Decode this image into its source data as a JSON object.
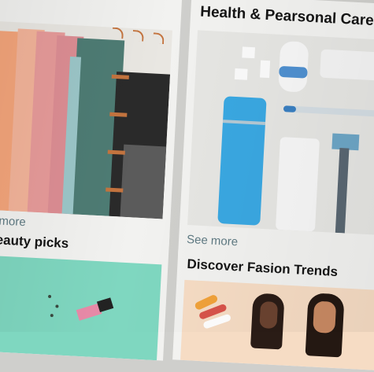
{
  "cards": {
    "home": {
      "see_more": "e more"
    },
    "health": {
      "title": "Health & Pearsonal Care",
      "see_more": "See more"
    },
    "beauty": {
      "title": "eauty picks"
    },
    "fashion": {
      "title": "Discover Fasion Trends"
    }
  },
  "colors": {
    "page_background": "#cfcfcc",
    "card_background": "#f2f2f0",
    "link": "#5f7a83",
    "title_text": "#151515",
    "bottle_blue": "#3aa8e2",
    "beauty_background": "#7fd7c0"
  }
}
